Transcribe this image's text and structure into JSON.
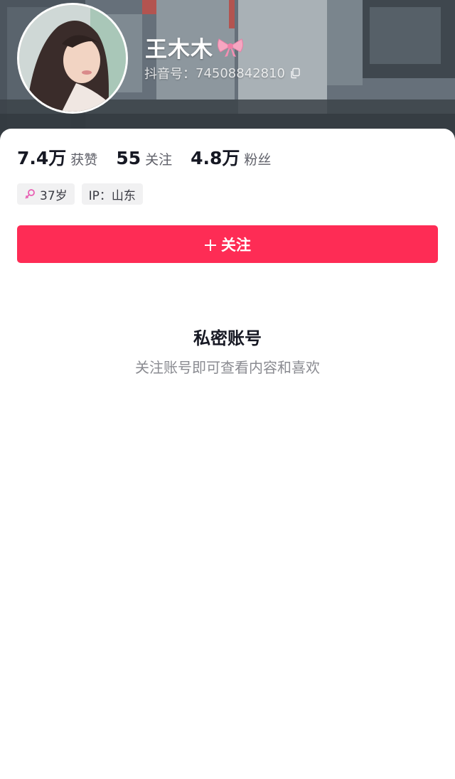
{
  "profile": {
    "nickname": "王木木",
    "nickname_emoji_icon": "ribbon-bow-icon",
    "douyin_id_label": "抖音号：",
    "douyin_id": "74508842810",
    "copy_icon": "copy-icon"
  },
  "stats": [
    {
      "value": "7.4万",
      "label": "获赞"
    },
    {
      "value": "55",
      "label": "关注"
    },
    {
      "value": "4.8万",
      "label": "粉丝"
    }
  ],
  "tags": {
    "gender_icon": "female-icon",
    "age": "37岁",
    "ip": "IP：山东"
  },
  "follow_button": {
    "label": "关注",
    "icon": "plus-icon"
  },
  "private_notice": {
    "title": "私密账号",
    "subtitle": "关注账号即可查看内容和喜欢"
  },
  "colors": {
    "accent": "#fe2c55",
    "gender_pink": "#e85fb3",
    "text_primary": "#161823",
    "text_secondary": "#8a8b91",
    "tag_bg": "#f1f1f2"
  }
}
